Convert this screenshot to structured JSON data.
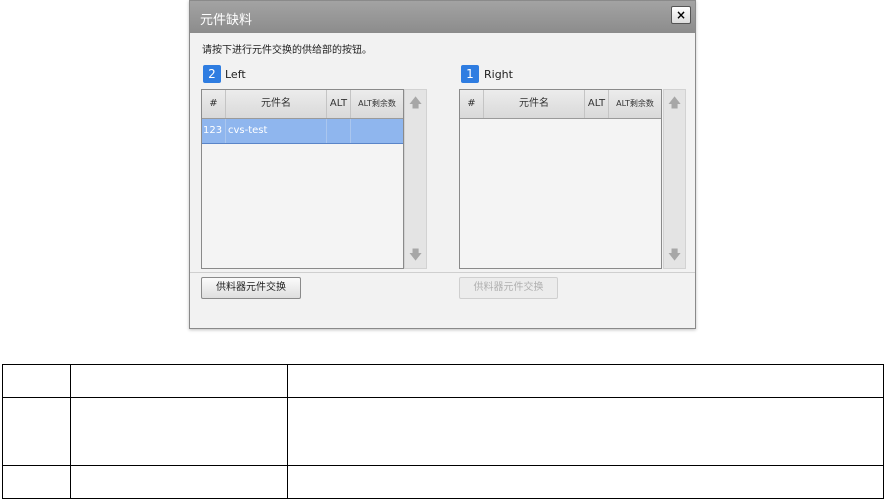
{
  "dialog": {
    "title": "元件缺料",
    "close_label": "×",
    "instruction": "请按下进行元件交换的供给部的按钮。"
  },
  "left_panel": {
    "badge": "2",
    "label": "Left",
    "columns": [
      "#",
      "元件名",
      "ALT",
      "ALT剩余数"
    ],
    "rows": [
      {
        "num": "123",
        "name": "cvs-test",
        "alt": "",
        "alt_remaining": ""
      }
    ],
    "exchange_button": "供料器元件交换"
  },
  "right_panel": {
    "badge": "1",
    "label": "Right",
    "columns": [
      "#",
      "元件名",
      "ALT",
      "ALT剩余数"
    ],
    "rows": [],
    "exchange_button": "供料器元件交换"
  },
  "icons": {
    "scroll_up": "arrow-up-icon",
    "scroll_down": "arrow-down-icon",
    "up_glyph": "🡅",
    "down_glyph": "🡇"
  },
  "doc_table": {
    "rows": [
      [
        "",
        "",
        ""
      ],
      [
        "",
        "",
        ""
      ],
      [
        "",
        "",
        ""
      ]
    ]
  }
}
